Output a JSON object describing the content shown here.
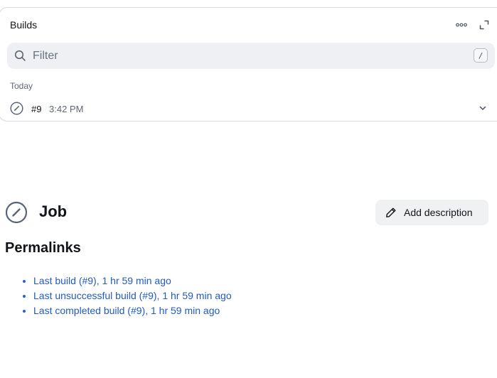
{
  "builds": {
    "title": "Builds",
    "more_icon": "more-horizontal-icon",
    "expand_icon": "expand-icon",
    "filter": {
      "placeholder": "Filter",
      "shortcut_key": "/"
    },
    "groups": [
      {
        "label": "Today",
        "items": [
          {
            "number": "#9",
            "time": "3:42 PM",
            "status_icon": "aborted-status-icon"
          }
        ]
      }
    ]
  },
  "job": {
    "title": "Job",
    "status_icon": "aborted-status-icon",
    "add_description_label": "Add description"
  },
  "permalinks": {
    "title": "Permalinks",
    "links": [
      "Last build (#9), 1 hr 59 min ago",
      "Last unsuccessful build (#9), 1 hr 59 min ago",
      "Last completed build (#9), 1 hr 59 min ago"
    ]
  },
  "colors": {
    "link": "#2159c4",
    "status_icon": "#5a6677",
    "filter_bg": "#eef0f4"
  }
}
